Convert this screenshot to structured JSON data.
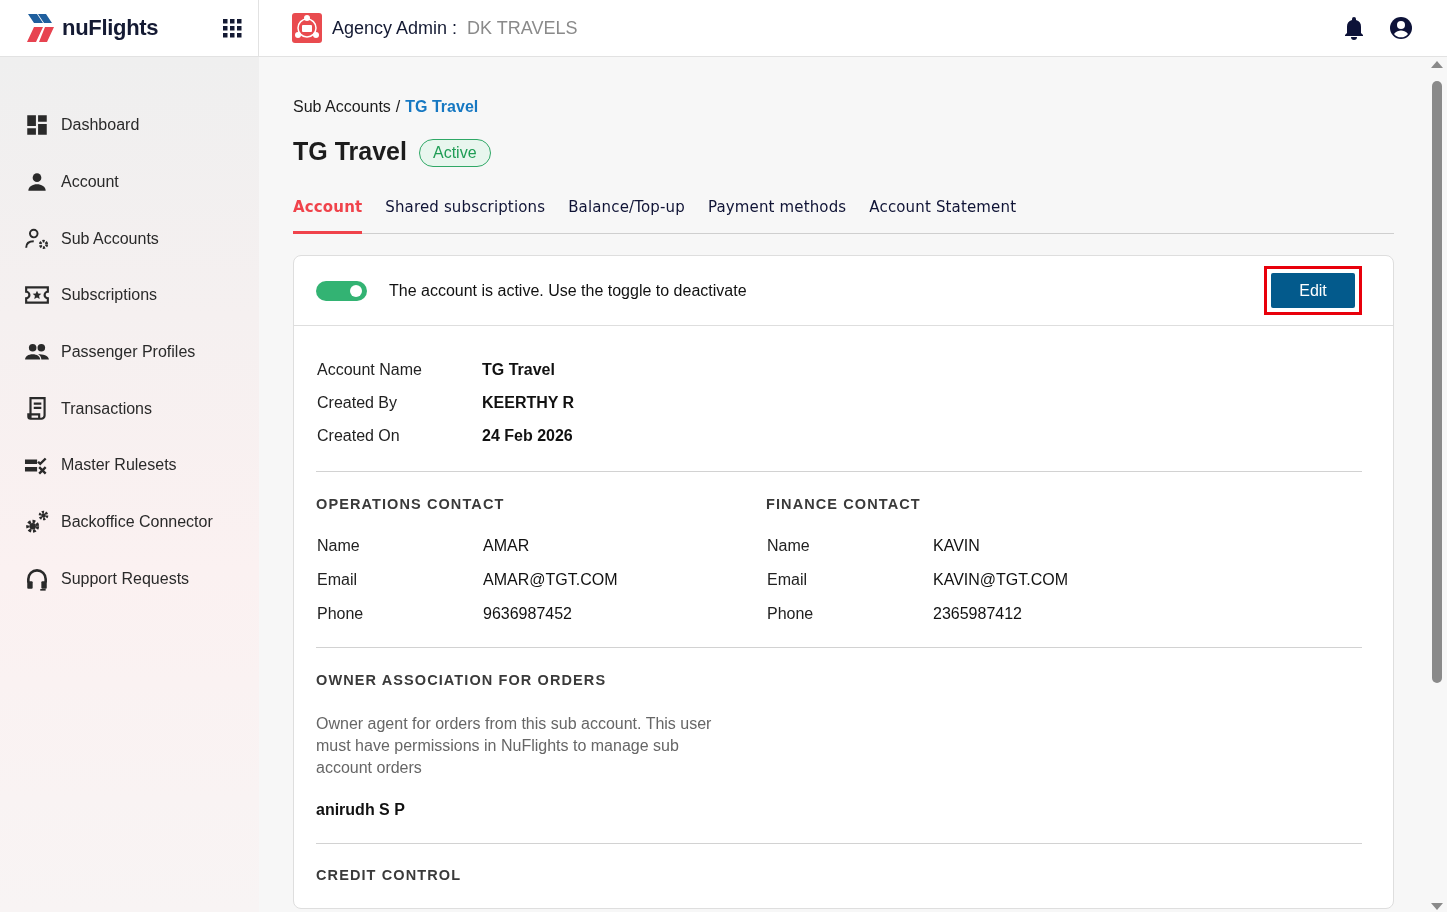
{
  "header": {
    "logo": "nuFlights",
    "title": "Agency Admin :",
    "agency": "DK TRAVELS"
  },
  "sidebar": {
    "items": [
      {
        "label": "Dashboard",
        "selected": false
      },
      {
        "label": "Account",
        "selected": false
      },
      {
        "label": "Sub Accounts",
        "selected": false
      },
      {
        "label": "Subscriptions",
        "selected": false
      },
      {
        "label": "Passenger Profiles",
        "selected": false
      },
      {
        "label": "Transactions",
        "selected": false
      },
      {
        "label": "Master Rulesets",
        "selected": false
      },
      {
        "label": "Backoffice Connector",
        "selected": false
      },
      {
        "label": "Support Requests",
        "selected": false
      }
    ]
  },
  "breadcrumb": {
    "separator": "/",
    "items": [
      {
        "label": "Sub Accounts",
        "current": false
      },
      {
        "label": "TG Travel",
        "current": true
      }
    ]
  },
  "page": {
    "title": "TG Travel",
    "status": "Active"
  },
  "tabs": [
    {
      "label": "Account",
      "selected": true
    },
    {
      "label": "Shared subscriptions",
      "selected": false
    },
    {
      "label": "Balance/Top-up",
      "selected": false
    },
    {
      "label": "Payment methods",
      "selected": false
    },
    {
      "label": "Account Statement",
      "selected": false
    }
  ],
  "status_card": {
    "toggle_on": true,
    "message": "The account is active. Use the toggle to deactivate",
    "edit_button": {
      "label": "Edit",
      "highlighted": true
    }
  },
  "details": [
    {
      "label": "Account Name",
      "value": "TG Travel"
    },
    {
      "label": "Created By",
      "value": "KEERTHY R"
    },
    {
      "label": "Created On",
      "value": "24 Feb 2026"
    }
  ],
  "contacts": [
    {
      "heading": "OPERATIONS CONTACT",
      "rows": [
        {
          "label": "Name",
          "value": "AMAR"
        },
        {
          "label": "Email",
          "value": "AMAR@TGT.COM"
        },
        {
          "label": "Phone",
          "value": "9636987452"
        }
      ]
    },
    {
      "heading": "FINANCE CONTACT",
      "rows": [
        {
          "label": "Name",
          "value": "KAVIN"
        },
        {
          "label": "Email",
          "value": "KAVIN@TGT.COM"
        },
        {
          "label": "Phone",
          "value": "2365987412"
        }
      ]
    }
  ],
  "owner_association": {
    "heading": "OWNER ASSOCIATION FOR ORDERS",
    "description": "Owner agent for orders from this sub account. This user must have permissions in NuFlights to manage sub account orders",
    "value": "anirudh S P"
  },
  "credit_control": {
    "heading": "CREDIT CONTROL"
  }
}
